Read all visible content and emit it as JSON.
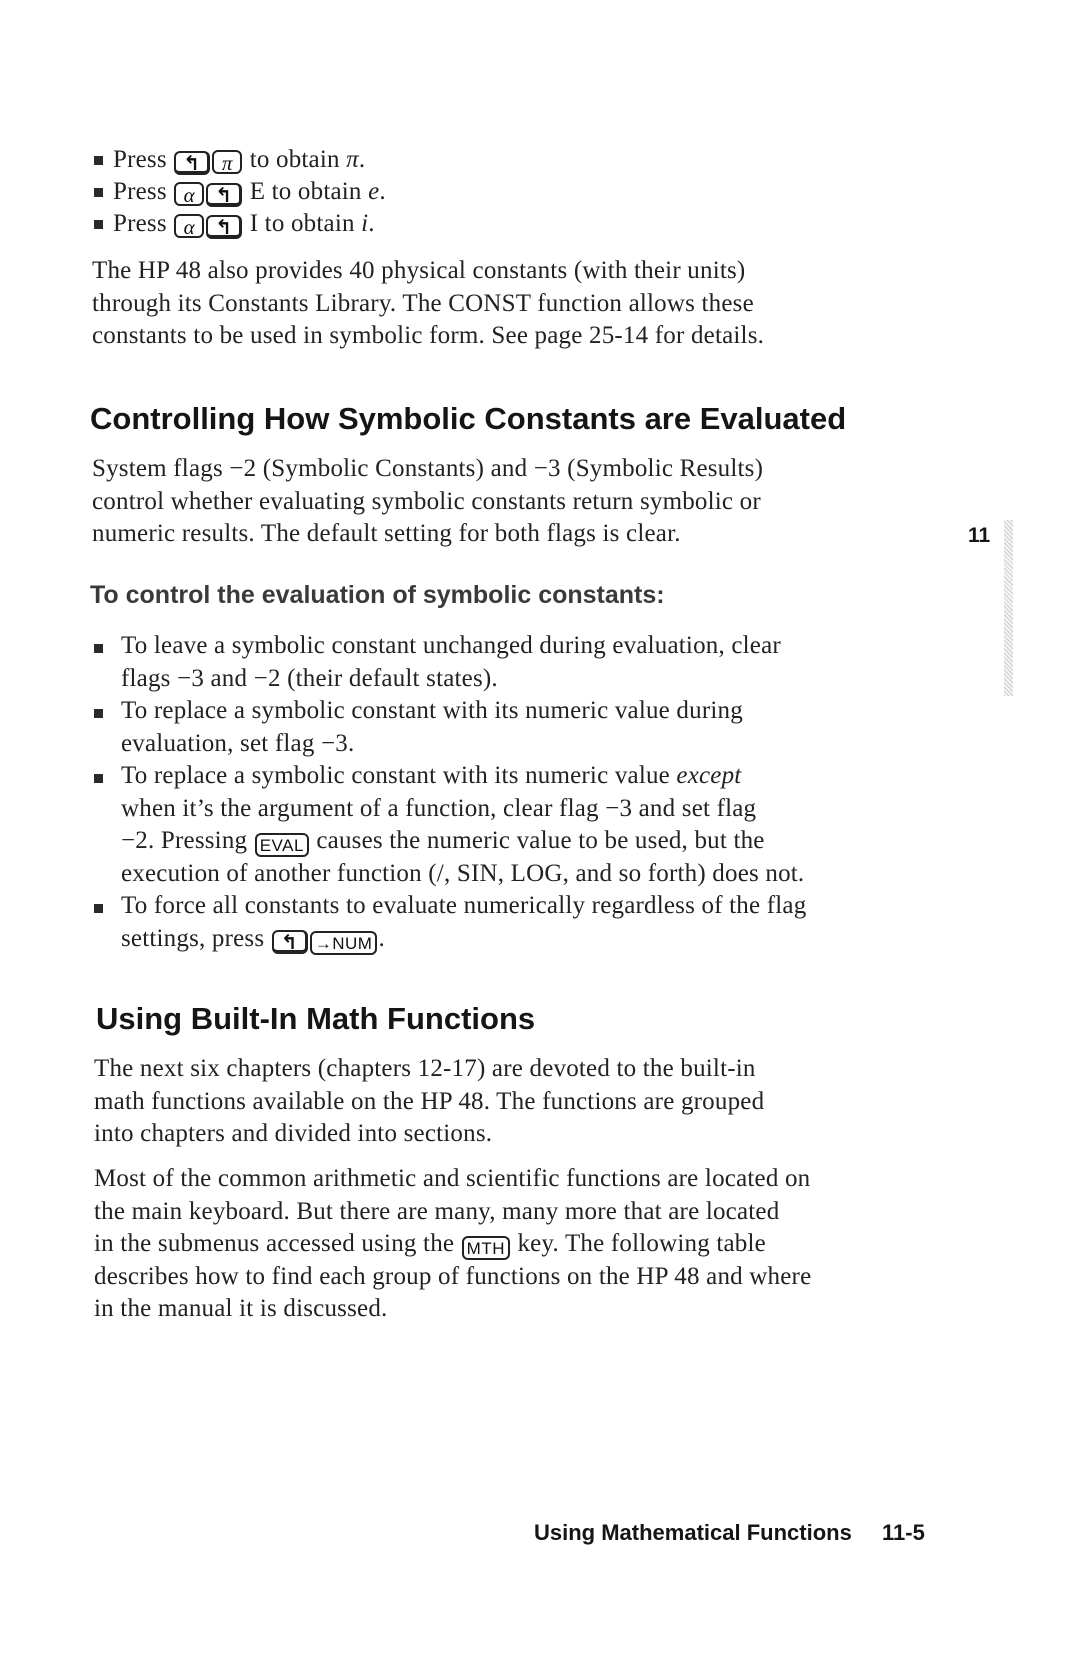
{
  "intro_bullets": [
    {
      "prefix": "Press",
      "keys": [
        {
          "label": "↰",
          "kind": "shift",
          "name": "left-shift-key"
        },
        {
          "label": "π",
          "kind": "sym",
          "name": "pi-key"
        }
      ],
      "suffix": "to obtain",
      "result": "π",
      "end": "."
    },
    {
      "prefix": "Press",
      "keys": [
        {
          "label": "α",
          "kind": "sym",
          "name": "alpha-key"
        },
        {
          "label": "↰",
          "kind": "shift",
          "name": "left-shift-key"
        }
      ],
      "suffix": "E to obtain",
      "result": "e",
      "end": "."
    },
    {
      "prefix": "Press",
      "keys": [
        {
          "label": "α",
          "kind": "sym",
          "name": "alpha-key"
        },
        {
          "label": "↰",
          "kind": "shift",
          "name": "left-shift-key"
        }
      ],
      "suffix": "I to obtain",
      "result": "i",
      "end": "."
    }
  ],
  "constants_paragraph": [
    "The HP 48 also provides 40 physical constants (with their units)",
    "through its Constants Library.  The CONST function allows these",
    "constants to be used in symbolic form.  See page 25-14 for details."
  ],
  "section1": {
    "heading": "Controlling How Symbolic Constants are Evaluated",
    "paragraph": [
      "System flags −2 (Symbolic Constants) and −3 (Symbolic Results)",
      "control whether evaluating symbolic constants return symbolic or",
      "numeric results.  The default setting for both flags is clear."
    ],
    "subheading": "To control the evaluation of symbolic constants:",
    "bullets": {
      "b1": [
        "To leave a symbolic constant unchanged during evaluation, clear",
        "flags −3 and −2 (their default states)."
      ],
      "b2": [
        "To replace a symbolic constant with its numeric value during",
        "evaluation, set flag −3."
      ],
      "b3": {
        "l1_pre": "To replace a symbolic constant with its numeric value ",
        "l1_em": "except",
        "l2": "when it’s the argument of a function, clear flag −3 and set flag",
        "l3_pre": "−2.  Pressing",
        "l3_key": "EVAL",
        "l3_post": "causes the numeric value to be used, but the",
        "l4": "execution of another function (/, SIN, LOG, and so forth) does not."
      },
      "b4": {
        "l1": "To force all constants to evaluate numerically regardless of the flag",
        "l2_pre": "settings, press",
        "l2_key1": "↰",
        "l2_key2": "→NUM",
        "l2_post": "."
      }
    }
  },
  "section2": {
    "heading": "Using Built-In Math Functions",
    "paragraph1": [
      "The next six chapters (chapters 12-17) are devoted to the built-in",
      "math functions available on the HP 48.  The functions are grouped",
      "into chapters and divided into sections."
    ],
    "paragraph2": {
      "l1": "Most of the common arithmetic and scientific functions are located on",
      "l2": "the main keyboard.  But there are many, many more that are located",
      "l3_pre": "in the submenus accessed using the",
      "l3_key": "MTH",
      "l3_post": "key.  The following table",
      "l4": "describes how to find each group of functions on the HP 48 and where",
      "l5": "in the manual it is discussed."
    }
  },
  "chapter_tab": "11",
  "footer": {
    "title": "Using Mathematical Functions",
    "page": "11-5"
  }
}
